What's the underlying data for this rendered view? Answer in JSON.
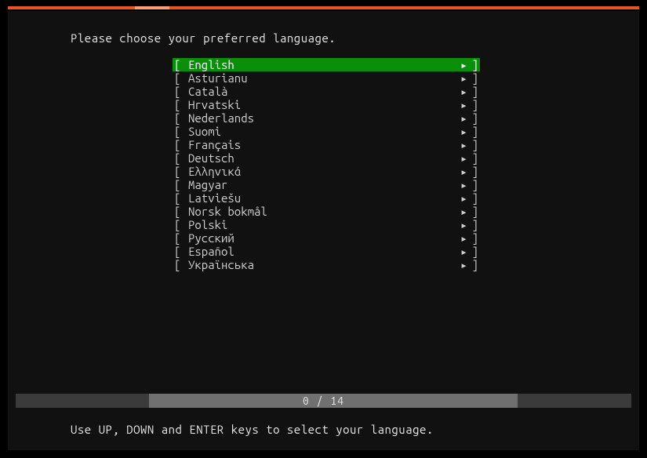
{
  "prompt": "Please choose your preferred language.",
  "languages": [
    {
      "label": "English",
      "selected": true
    },
    {
      "label": "Asturianu",
      "selected": false
    },
    {
      "label": "Català",
      "selected": false
    },
    {
      "label": "Hrvatski",
      "selected": false
    },
    {
      "label": "Nederlands",
      "selected": false
    },
    {
      "label": "Suomi",
      "selected": false
    },
    {
      "label": "Français",
      "selected": false
    },
    {
      "label": "Deutsch",
      "selected": false
    },
    {
      "label": "Ελληνικά",
      "selected": false
    },
    {
      "label": "Magyar",
      "selected": false
    },
    {
      "label": "Latviešu",
      "selected": false
    },
    {
      "label": "Norsk bokmål",
      "selected": false
    },
    {
      "label": "Polski",
      "selected": false
    },
    {
      "label": "Русский",
      "selected": false
    },
    {
      "label": "Español",
      "selected": false
    },
    {
      "label": "Українська",
      "selected": false
    }
  ],
  "brackets": {
    "left": "[",
    "right": "]",
    "arrow": "▸"
  },
  "progress": {
    "current": 0,
    "total": 14,
    "display": "0 / 14"
  },
  "footer": "Use UP, DOWN and ENTER keys to select your language."
}
